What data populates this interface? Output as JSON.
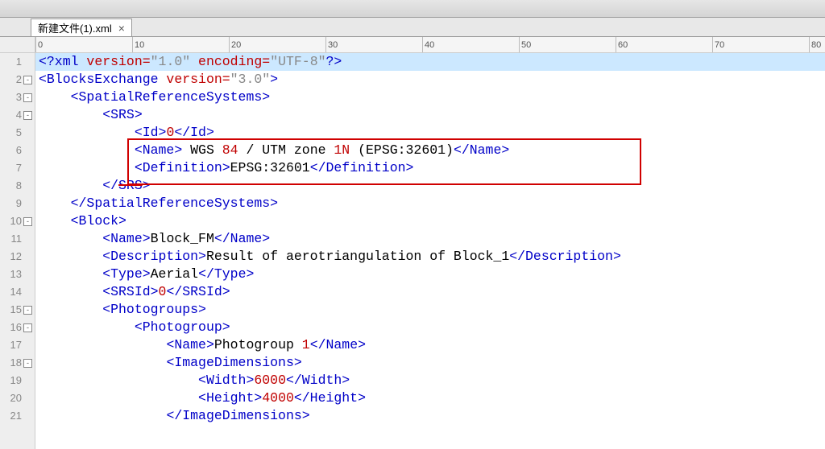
{
  "tab": {
    "title": "新建文件(1).xml"
  },
  "ruler": {
    "ticks": [
      0,
      10,
      20,
      30,
      40,
      50,
      60,
      70,
      80
    ]
  },
  "lines": {
    "l1": {
      "num": "1",
      "p1": "<?xml",
      "a1": " version=",
      "v1": "\"1.0\"",
      "a2": " encoding=",
      "v2": "\"UTF-8\"",
      "p2": "?>"
    },
    "l2": {
      "num": "2",
      "fold": "-",
      "t1": "<BlocksExchange",
      "a1": " version=",
      "v1": "\"3.0\"",
      "t2": ">"
    },
    "l3": {
      "num": "3",
      "fold": "-",
      "t": "<SpatialReferenceSystems>"
    },
    "l4": {
      "num": "4",
      "fold": "-",
      "t": "<SRS>"
    },
    "l5": {
      "num": "5",
      "o": "<Id>",
      "v": "0",
      "c": "</Id>"
    },
    "l6": {
      "num": "6",
      "o": "<Name>",
      "v1": " WGS ",
      "r": "84",
      "v2": " / UTM zone ",
      "r2": "1N",
      "v3": " (EPSG:32601)",
      "c": "</Name>"
    },
    "l7": {
      "num": "7",
      "o": "<Definition>",
      "v": "EPSG:32601",
      "c": "</Definition>"
    },
    "l8": {
      "num": "8",
      "t": "</SRS>"
    },
    "l9": {
      "num": "9",
      "t": "</SpatialReferenceSystems>"
    },
    "l10": {
      "num": "10",
      "fold": "-",
      "t": "<Block>"
    },
    "l11": {
      "num": "11",
      "o": "<Name>",
      "v": "Block_FM",
      "c": "</Name>"
    },
    "l12": {
      "num": "12",
      "o": "<Description>",
      "v": "Result of aerotriangulation of Block_1",
      "c": "</Description>"
    },
    "l13": {
      "num": "13",
      "o": "<Type>",
      "v": "Aerial",
      "c": "</Type>"
    },
    "l14": {
      "num": "14",
      "o": "<SRSId>",
      "v": "0",
      "c": "</SRSId>"
    },
    "l15": {
      "num": "15",
      "fold": "-",
      "t": "<Photogroups>"
    },
    "l16": {
      "num": "16",
      "fold": "-",
      "t": "<Photogroup>"
    },
    "l17": {
      "num": "17",
      "o": "<Name>",
      "v": "Photogroup ",
      "r": "1",
      "c": "</Name>"
    },
    "l18": {
      "num": "18",
      "fold": "-",
      "t": "<ImageDimensions>"
    },
    "l19": {
      "num": "19",
      "o": "<Width>",
      "v": "6000",
      "c": "</Width>"
    },
    "l20": {
      "num": "20",
      "o": "<Height>",
      "v": "4000",
      "c": "</Height>"
    },
    "l21": {
      "num": "21",
      "t": "</ImageDimensions>"
    }
  }
}
